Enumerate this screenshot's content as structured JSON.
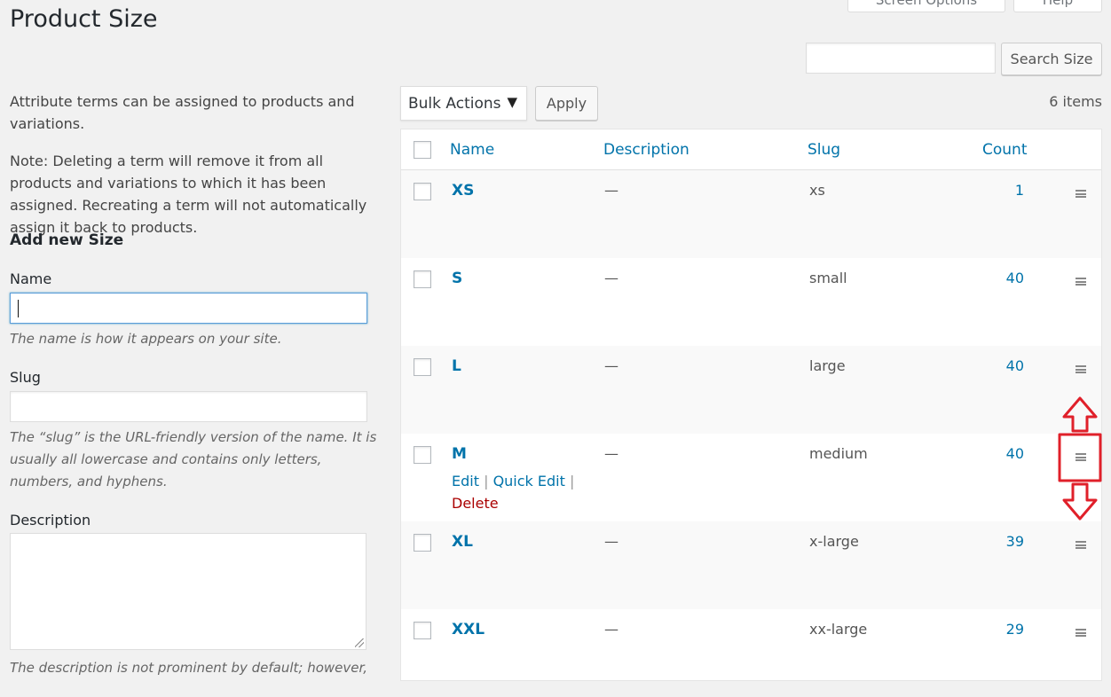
{
  "top_tabs": {
    "screen_options": "Screen Options",
    "help": "Help"
  },
  "page_title": "Product Size",
  "search": {
    "button_label": "Search Size",
    "value": ""
  },
  "left": {
    "intro": "Attribute terms can be assigned to products and variations.",
    "note": "Note: Deleting a term will remove it from all products and variations to which it has been assigned. Recreating a term will not automatically assign it back to products.",
    "add_heading": "Add new Size",
    "name_label": "Name",
    "name_help": "The name is how it appears on your site.",
    "slug_label": "Slug",
    "slug_help": "The “slug” is the URL-friendly version of the name. It is usually all lowercase and contains only letters, numbers, and hyphens.",
    "description_label": "Description",
    "description_help": "The description is not prominent by default; however,"
  },
  "bulk_actions": {
    "selected": "Bulk Actions",
    "arrow": "▼",
    "apply": "Apply"
  },
  "items_count": "6 items",
  "table": {
    "columns": {
      "name": "Name",
      "description": "Description",
      "slug": "Slug",
      "count": "Count"
    },
    "rows": [
      {
        "name": "XS",
        "description": "—",
        "slug": "xs",
        "count": "1"
      },
      {
        "name": "S",
        "description": "—",
        "slug": "small",
        "count": "40"
      },
      {
        "name": "L",
        "description": "—",
        "slug": "large",
        "count": "40"
      },
      {
        "name": "M",
        "description": "—",
        "slug": "medium",
        "count": "40"
      },
      {
        "name": "XL",
        "description": "—",
        "slug": "x-large",
        "count": "39"
      },
      {
        "name": "XXL",
        "description": "—",
        "slug": "xx-large",
        "count": "29"
      }
    ],
    "row_actions": {
      "edit": "Edit",
      "quick_edit": "Quick Edit",
      "separator": "|",
      "delete": "Delete"
    }
  },
  "annotation_color": "#e0202a"
}
